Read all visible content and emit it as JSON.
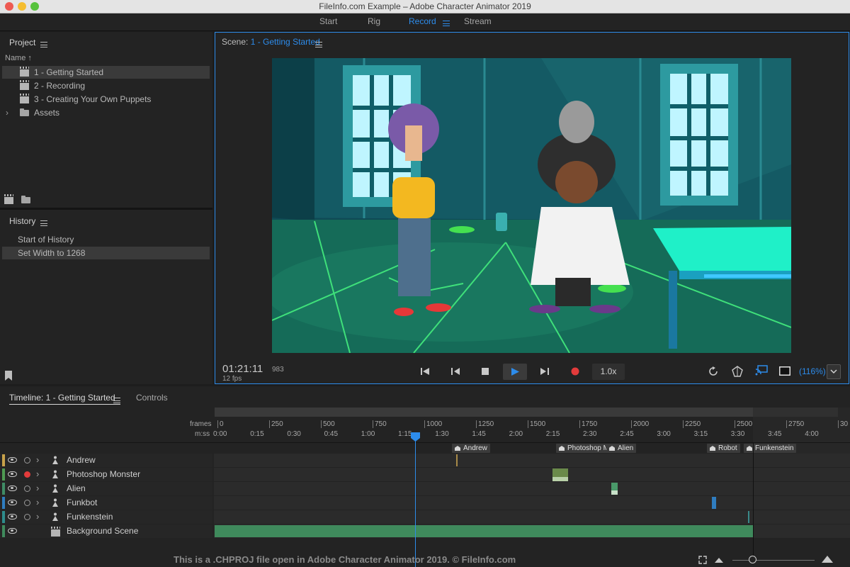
{
  "window": {
    "title": "FileInfo.com Example – Adobe Character Animator 2019"
  },
  "workspaces": [
    {
      "label": "Start"
    },
    {
      "label": "Rig"
    },
    {
      "label": "Record"
    },
    {
      "label": "Stream"
    }
  ],
  "project": {
    "title": "Project",
    "sort_label": "Name",
    "items": [
      {
        "label": "1 - Getting Started",
        "icon": "scene-icon"
      },
      {
        "label": "2 - Recording",
        "icon": "scene-icon"
      },
      {
        "label": "3 - Creating Your Own Puppets",
        "icon": "scene-icon"
      },
      {
        "label": "Assets",
        "icon": "folder-icon"
      }
    ]
  },
  "history": {
    "title": "History",
    "items": [
      {
        "label": "Start of History"
      },
      {
        "label": "Set Width to 1268"
      }
    ]
  },
  "scene": {
    "prefix": "Scene:",
    "name": "1 - Getting Started",
    "timecode": "01:21:11",
    "frame": "983",
    "fps": "12 fps",
    "speed": "1.0x",
    "zoom": "(116%)"
  },
  "timeline": {
    "tab": "Timeline: 1 - Getting Started",
    "controls_tab": "Controls",
    "frames_label": "frames",
    "mss_label": "m:ss",
    "frame_ticks": [
      "0",
      "250",
      "500",
      "750",
      "1000",
      "1250",
      "1500",
      "1750",
      "2000",
      "2250",
      "2500",
      "2750",
      "30"
    ],
    "time_ticks": [
      "0:00",
      "0:15",
      "0:30",
      "0:45",
      "1:00",
      "1:15",
      "1:30",
      "1:45",
      "2:00",
      "2:15",
      "2:30",
      "2:45",
      "3:00",
      "3:15",
      "3:30",
      "3:45",
      "4:00"
    ],
    "markers": [
      "Andrew",
      "Photoshop Mo",
      "Alien",
      "Robot",
      "Funkenstein"
    ],
    "tracks": [
      {
        "name": "Andrew",
        "color": "#c7a14a"
      },
      {
        "name": "Photoshop Monster",
        "color": "#4e9a52"
      },
      {
        "name": "Alien",
        "color": "#3f8c65"
      },
      {
        "name": "Funkbot",
        "color": "#2f7dc0"
      },
      {
        "name": "Funkenstein",
        "color": "#2e8c8c"
      },
      {
        "name": "Background Scene",
        "color": "#3f8a5c"
      }
    ]
  },
  "footer": {
    "caption": "This is a .CHPROJ file open in Adobe Character Animator 2019. © FileInfo.com"
  }
}
